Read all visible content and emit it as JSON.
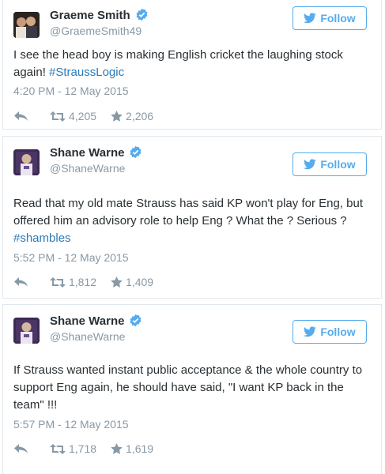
{
  "tweets": [
    {
      "name": "Graeme Smith",
      "handle": "@GraemeSmith49",
      "follow_label": "Follow",
      "text_parts": [
        "I see the head boy is making English cricket the laughing stock again! "
      ],
      "hashtag": "#StraussLogic",
      "timestamp": "4:20 PM - 12 May 2015",
      "retweets": "4,205",
      "favorites": "2,206"
    },
    {
      "name": "Shane Warne",
      "handle": "@ShaneWarne",
      "follow_label": "Follow",
      "text_parts": [
        "Read that my old mate Strauss has said KP won't play for Eng, but offered him an advisory role to help Eng ? What the ? Serious ? "
      ],
      "hashtag": "#shambles",
      "timestamp": "5:52 PM - 12 May 2015",
      "retweets": "1,812",
      "favorites": "1,409"
    },
    {
      "name": "Shane Warne",
      "handle": "@ShaneWarne",
      "follow_label": "Follow",
      "text_parts": [
        "If Strauss wanted instant public acceptance & the whole country to support Eng again, he should have said, \"I want KP back in the team\" !!!"
      ],
      "hashtag": "",
      "timestamp": "5:57 PM - 12 May 2015",
      "retweets": "1,718",
      "favorites": "1,619"
    }
  ],
  "icons": {
    "verified": "verified-badge-icon",
    "follow": "twitter-bird-icon",
    "reply": "reply-icon",
    "retweet": "retweet-icon",
    "favorite": "star-icon"
  },
  "colors": {
    "twitter_blue": "#55acee",
    "hashtag": "#2b7bb9",
    "muted": "#8899a6",
    "text": "#292f33"
  }
}
